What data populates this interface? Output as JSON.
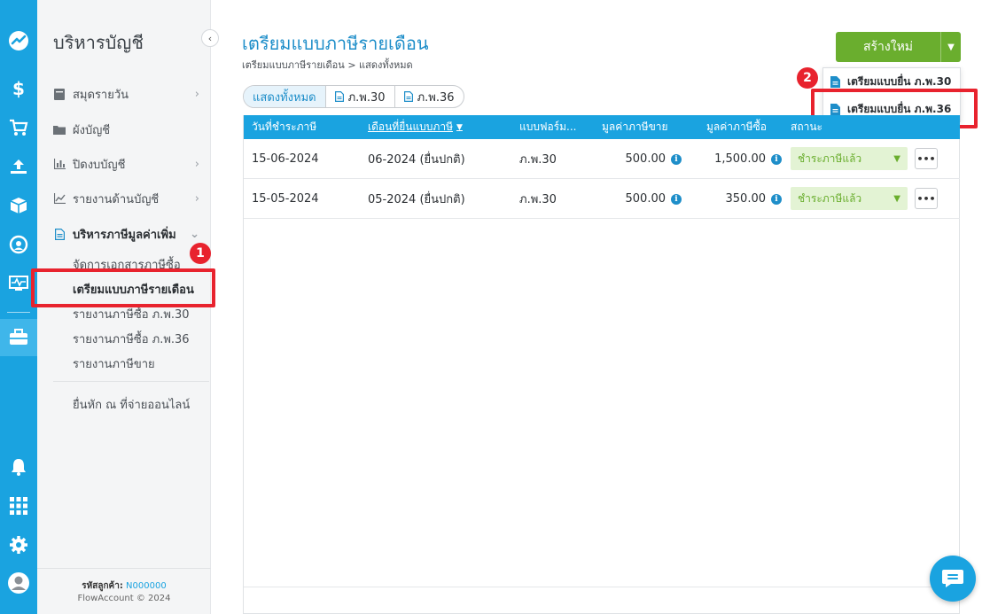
{
  "colors": {
    "primary": "#1aa3e0",
    "accent_green": "#6aae2e",
    "highlight_red": "#e8232e",
    "title_blue": "#1e8ec9"
  },
  "rail": {
    "icons": [
      "flowaccount-logo-icon",
      "dollar-icon",
      "cart-icon",
      "upload-tray-icon",
      "box-icon",
      "gauge-icon",
      "activity-monitor-icon",
      "briefcase-icon",
      "bell-icon",
      "apps-grid-icon",
      "settings-gear-icon",
      "user-avatar-icon"
    ]
  },
  "sidebar": {
    "title": "บริหารบัญชี",
    "items": [
      {
        "label": "สมุดรายวัน",
        "icon": "book-icon",
        "has_chevron": true
      },
      {
        "label": "ผังบัญชี",
        "icon": "folder-icon",
        "has_chevron": false
      },
      {
        "label": "ปิดงบบัญชี",
        "icon": "bar-chart-icon",
        "has_chevron": true
      },
      {
        "label": "รายงานด้านบัญชี",
        "icon": "line-chart-icon",
        "has_chevron": true
      },
      {
        "label": "บริหารภาษีมูลค่าเพิ่ม",
        "icon": "document-icon",
        "has_chevron": true,
        "expanded": true
      }
    ],
    "sub_items": [
      "จัดการเอกสารภาษีซื้อ",
      "เตรียมแบบภาษีรายเดือน",
      "รายงานภาษีซื้อ ภ.พ.30",
      "รายงานภาษีซื้อ ภ.พ.36",
      "รายงานภาษีขาย"
    ],
    "extra_item": "ยื่นหัก ณ ที่จ่ายออนไลน์",
    "footer": {
      "customer_label": "รหัสลูกค้า:",
      "customer_code": "N000000",
      "copyright": "FlowAccount © 2024"
    }
  },
  "annotations": {
    "badge_1": "1",
    "badge_2": "2"
  },
  "main": {
    "title": "เตรียมแบบภาษีรายเดือน",
    "breadcrumb": {
      "first": "เตรียมแบบภาษีรายเดือน",
      "sep": ">",
      "second": "แสดงทั้งหมด"
    },
    "create_button": "สร้างใหม่",
    "create_dropdown": [
      "เตรียมแบบยื่น ภ.พ.30",
      "เตรียมแบบยื่น ภ.พ.36"
    ],
    "filters": [
      {
        "label": "แสดงทั้งหมด",
        "active": true
      },
      {
        "label": "ภ.พ.30",
        "active": false
      },
      {
        "label": "ภ.พ.36",
        "active": false
      }
    ],
    "table": {
      "columns": [
        "วันที่ชำระภาษี",
        "เดือนที่ยื่นแบบภาษี",
        "แบบฟอร์ม...",
        "มูลค่าภาษีขาย",
        "มูลค่าภาษีซื้อ",
        "สถานะ"
      ],
      "rows": [
        {
          "pay_date": "15-06-2024",
          "file_month": "06-2024 (ยื่นปกติ)",
          "form": "ภ.พ.30",
          "sales_vat": "500.00",
          "purchase_vat": "1,500.00",
          "status": "ชำระภาษีแล้ว"
        },
        {
          "pay_date": "15-05-2024",
          "file_month": "05-2024 (ยื่นปกติ)",
          "form": "ภ.พ.30",
          "sales_vat": "500.00",
          "purchase_vat": "350.00",
          "status": "ชำระภาษีแล้ว"
        }
      ]
    }
  }
}
